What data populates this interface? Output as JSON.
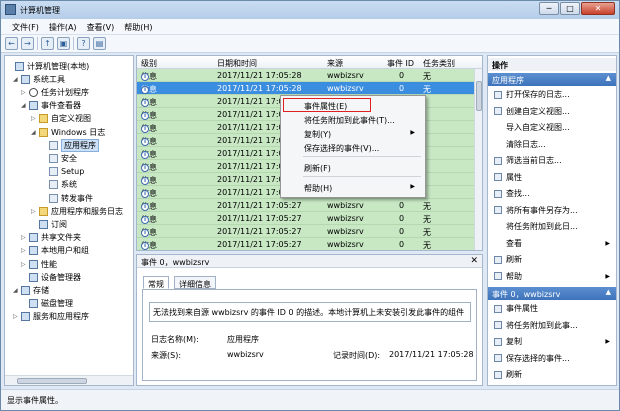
{
  "window": {
    "title": "计算机管理",
    "btn_min": "─",
    "btn_max": "□",
    "btn_close": "✕"
  },
  "menu": [
    "文件(F)",
    "操作(A)",
    "查看(V)",
    "帮助(H)"
  ],
  "toolbar_glyphs": [
    "←",
    "→",
    "↑",
    "▣",
    "?",
    "▤"
  ],
  "tree": [
    {
      "label": "计算机管理(本地)",
      "exp": "",
      "icon": "computer-icon"
    },
    {
      "label": "系统工具",
      "exp": "◢",
      "icon": "tools-icon"
    },
    {
      "label": "任务计划程序",
      "exp": "▷",
      "icon": "clock-icon"
    },
    {
      "label": "事件查看器",
      "exp": "◢",
      "icon": "event-viewer-icon"
    },
    {
      "label": "自定义视图",
      "exp": "▷",
      "icon": "folder-icon"
    },
    {
      "label": "Windows 日志",
      "exp": "◢",
      "icon": "folder-icon"
    },
    {
      "label": "应用程序",
      "exp": "",
      "icon": "log-icon"
    },
    {
      "label": "安全",
      "exp": "",
      "icon": "log-icon"
    },
    {
      "label": "Setup",
      "exp": "",
      "icon": "log-icon"
    },
    {
      "label": "系统",
      "exp": "",
      "icon": "log-icon"
    },
    {
      "label": "转发事件",
      "exp": "",
      "icon": "log-icon"
    },
    {
      "label": "应用程序和服务日志",
      "exp": "▷",
      "icon": "folder-icon"
    },
    {
      "label": "订阅",
      "exp": "",
      "icon": "subscription-icon"
    },
    {
      "label": "共享文件夹",
      "exp": "▷",
      "icon": "shared-folder-icon"
    },
    {
      "label": "本地用户和组",
      "exp": "▷",
      "icon": "users-icon"
    },
    {
      "label": "性能",
      "exp": "▷",
      "icon": "performance-icon"
    },
    {
      "label": "设备管理器",
      "exp": "",
      "icon": "device-manager-icon"
    },
    {
      "label": "存储",
      "exp": "◢",
      "icon": "storage-icon"
    },
    {
      "label": "磁盘管理",
      "exp": "",
      "icon": "disk-icon"
    },
    {
      "label": "服务和应用程序",
      "exp": "▷",
      "icon": "services-icon"
    }
  ],
  "list": {
    "columns": [
      "级别",
      "日期和时间",
      "来源",
      "事件 ID",
      "任务类别"
    ],
    "rows": [
      [
        "信息",
        "2017/11/21 17:05:28",
        "wwbizsrv",
        "0",
        "无"
      ],
      [
        "信息",
        "2017/11/21 17:05:28",
        "wwbizsrv",
        "0",
        "无"
      ],
      [
        "信息",
        "2017/11/21 17:05:28",
        "",
        "",
        ""
      ],
      [
        "信息",
        "2017/11/21 17:05:28",
        "",
        "",
        ""
      ],
      [
        "信息",
        "2017/11/21 17:05:28",
        "",
        "",
        ""
      ],
      [
        "信息",
        "2017/11/21 17:05:28",
        "",
        "",
        ""
      ],
      [
        "信息",
        "2017/11/21 17:05:28",
        "",
        "",
        ""
      ],
      [
        "信息",
        "2017/11/21 17:05:28",
        "",
        "",
        ""
      ],
      [
        "信息",
        "2017/11/21 17:05:28",
        "",
        "",
        ""
      ],
      [
        "信息",
        "2017/11/21 17:05:28",
        "",
        "",
        ""
      ],
      [
        "信息",
        "2017/11/21 17:05:27",
        "wwbizsrv",
        "0",
        "无"
      ],
      [
        "信息",
        "2017/11/21 17:05:27",
        "wwbizsrv",
        "0",
        "无"
      ],
      [
        "信息",
        "2017/11/21 17:05:27",
        "wwbizsrv",
        "0",
        "无"
      ],
      [
        "信息",
        "2017/11/21 17:05:27",
        "wwbizsrv",
        "0",
        "无"
      ]
    ]
  },
  "context_menu": [
    {
      "label": "事件属性(E)",
      "sub": false
    },
    {
      "label": "将任务附加到此事件(T)...",
      "sub": false
    },
    {
      "label": "复制(Y)",
      "sub": true
    },
    {
      "label": "保存选择的事件(V)...",
      "sub": false
    },
    {
      "label": "刷新(F)",
      "sub": false
    },
    {
      "label": "帮助(H)",
      "sub": true
    }
  ],
  "detail": {
    "title": "事件 0，wwbizsrv",
    "close": "✕",
    "tabs": [
      "常规",
      "详细信息"
    ],
    "description": "无法找到来自源 wwbizsrv 的事件 ID 0 的描述。本地计算机上未安装引发此事件的组件",
    "log_name_label": "日志名称(M):",
    "log_name_value": "应用程序",
    "source_label": "来源(S):",
    "source_value": "wwbizsrv",
    "logged_label": "记录时间(D):",
    "logged_value": "2017/11/21 17:05:28"
  },
  "actions": {
    "header": "操作",
    "group1": "应用程序",
    "items1": [
      {
        "label": "打开保存的日志...",
        "icon": "open-log-icon",
        "sub": false
      },
      {
        "label": "创建自定义视图...",
        "icon": "filter-icon",
        "sub": false
      },
      {
        "label": "导入自定义视图...",
        "icon": "",
        "sub": false
      },
      {
        "label": "清除日志...",
        "icon": "",
        "sub": false
      },
      {
        "label": "筛选当前日志...",
        "icon": "filter-icon",
        "sub": false
      },
      {
        "label": "属性",
        "icon": "properties-icon",
        "sub": false
      },
      {
        "label": "查找...",
        "icon": "find-icon",
        "sub": false
      },
      {
        "label": "将所有事件另存为...",
        "icon": "save-icon",
        "sub": false
      },
      {
        "label": "将任务附加到此日...",
        "icon": "",
        "sub": false
      },
      {
        "label": "查看",
        "icon": "",
        "sub": true
      },
      {
        "label": "刷新",
        "icon": "refresh-icon",
        "sub": false
      },
      {
        "label": "帮助",
        "icon": "help-icon",
        "sub": true
      }
    ],
    "group2": "事件 0，wwbizsrv",
    "items2": [
      {
        "label": "事件属性",
        "icon": "properties-icon",
        "sub": false
      },
      {
        "label": "将任务附加到此事...",
        "icon": "task-icon",
        "sub": false
      },
      {
        "label": "复制",
        "icon": "copy-icon",
        "sub": true
      },
      {
        "label": "保存选择的事件...",
        "icon": "save-icon",
        "sub": false
      },
      {
        "label": "刷新",
        "icon": "refresh-icon",
        "sub": false
      }
    ]
  },
  "status": "显示事件属性。",
  "arrows": {
    "collapse": "▲",
    "sub": "▶",
    "scroll_up": "▲",
    "scroll_down": "▼"
  }
}
